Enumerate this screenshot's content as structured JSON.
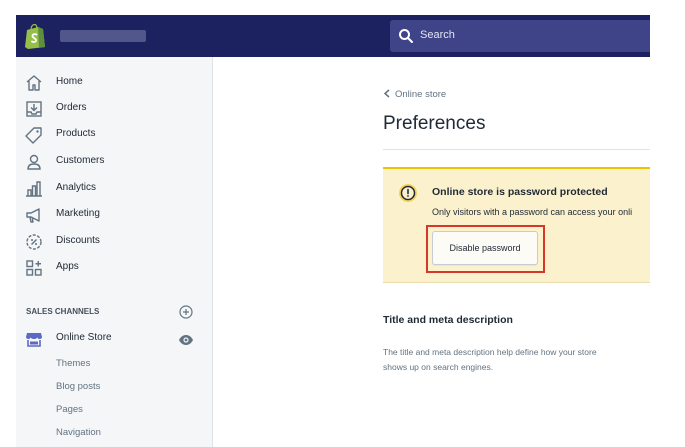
{
  "header": {
    "search_placeholder": "Search"
  },
  "sidebar": {
    "items": [
      {
        "label": "Home",
        "icon": "home-icon"
      },
      {
        "label": "Orders",
        "icon": "orders-icon"
      },
      {
        "label": "Products",
        "icon": "tag-icon"
      },
      {
        "label": "Customers",
        "icon": "customer-icon"
      },
      {
        "label": "Analytics",
        "icon": "analytics-icon"
      },
      {
        "label": "Marketing",
        "icon": "megaphone-icon"
      },
      {
        "label": "Discounts",
        "icon": "discount-icon"
      },
      {
        "label": "Apps",
        "icon": "apps-icon"
      }
    ],
    "sales_channels_heading": "SALES CHANNELS",
    "online_store": {
      "label": "Online Store",
      "icon": "store-icon"
    },
    "sub_items": [
      "Themes",
      "Blog posts",
      "Pages",
      "Navigation"
    ]
  },
  "main": {
    "breadcrumb": "Online store",
    "title": "Preferences",
    "banner": {
      "title": "Online store is password protected",
      "body": "Only visitors with a password can access your onli",
      "button_label": "Disable password"
    },
    "section": {
      "title": "Title and meta description",
      "description": "The title and meta description help define how your store shows up on search engines."
    }
  },
  "colors": {
    "topbar": "#1c2260",
    "search_bg": "#3f4489",
    "sidebar_bg": "#f4f6f8",
    "banner_bg": "#fcf1cd",
    "banner_accent": "#eec200",
    "highlight": "#d6372b",
    "logo_green": "#95bf47"
  }
}
